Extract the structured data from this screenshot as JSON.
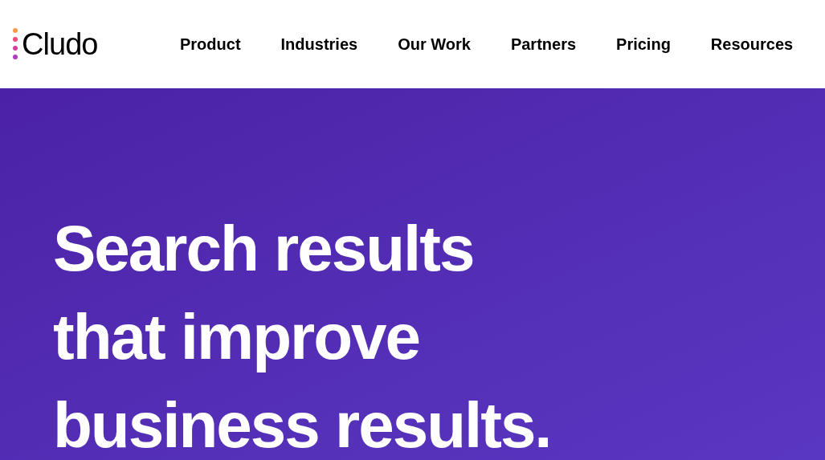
{
  "logo": {
    "text": "Cludo"
  },
  "nav": [
    {
      "label": "Product"
    },
    {
      "label": "Industries"
    },
    {
      "label": "Our Work"
    },
    {
      "label": "Partners"
    },
    {
      "label": "Pricing"
    },
    {
      "label": "Resources"
    }
  ],
  "hero": {
    "headline_lines": [
      "Search results",
      "that improve",
      "business results."
    ]
  }
}
